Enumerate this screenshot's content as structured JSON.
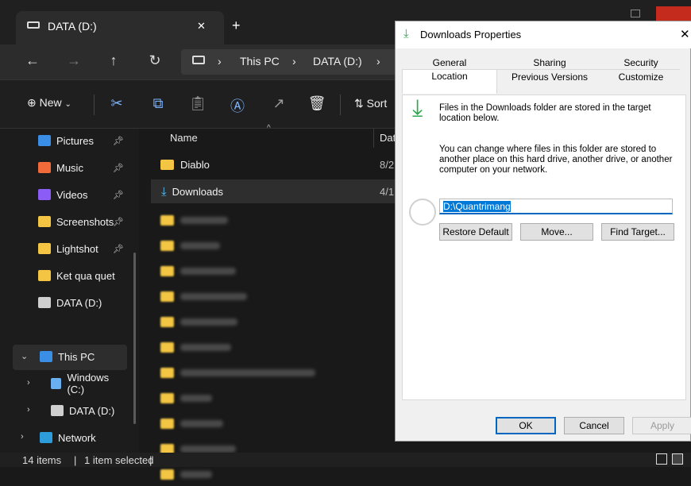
{
  "tab": {
    "title": "DATA (D:)",
    "close": "✕",
    "new": "+"
  },
  "nav": {
    "back": "←",
    "forward": "→",
    "up": "↑",
    "refresh": "↻"
  },
  "breadcrumb": {
    "items": [
      "This PC",
      "DATA (D:)"
    ],
    "sep": "›"
  },
  "toolbar": {
    "new_label": "New",
    "sort_label": "Sort"
  },
  "sidebar": {
    "items": [
      {
        "label": "Pictures",
        "icon": "pictures-icon",
        "color": "#3a8ee6"
      },
      {
        "label": "Music",
        "icon": "music-icon",
        "color": "#f06a3a"
      },
      {
        "label": "Videos",
        "icon": "videos-icon",
        "color": "#8b5cf6"
      },
      {
        "label": "Screenshots",
        "icon": "folder-icon",
        "color": "#f4c542"
      },
      {
        "label": "Lightshot",
        "icon": "folder-icon",
        "color": "#f4c542"
      },
      {
        "label": "Ket qua quet",
        "icon": "folder-icon",
        "color": "#f4c542"
      },
      {
        "label": "DATA (D:)",
        "icon": "drive-icon",
        "color": "#cfcfcf"
      }
    ],
    "tree": [
      {
        "label": "This PC"
      },
      {
        "label": "Windows (C:)"
      },
      {
        "label": "DATA (D:)"
      },
      {
        "label": "Network"
      }
    ]
  },
  "list": {
    "columns": {
      "name": "Name",
      "date": "Dat"
    },
    "rows": [
      {
        "name": "Diablo",
        "date": "8/2"
      },
      {
        "name": "Downloads",
        "date": "4/1"
      }
    ]
  },
  "status": {
    "items": "14 items",
    "selected": "1 item selected"
  },
  "dialog": {
    "title": "Downloads Properties",
    "tabs_row1": [
      "General",
      "Sharing",
      "Security"
    ],
    "tabs_row2": [
      "Location",
      "Previous Versions",
      "Customize"
    ],
    "desc1": "Files in the Downloads folder are stored in the target location below.",
    "desc2": "You can change where files in this folder are stored to another place on this hard drive, another drive, or another computer on your network.",
    "path": "D:\\Quantrimang",
    "buttons": {
      "restore": "Restore Default",
      "move": "Move...",
      "find": "Find Target..."
    },
    "footer": {
      "ok": "OK",
      "cancel": "Cancel",
      "apply": "Apply"
    }
  },
  "colors": {
    "accent": "#0078d7",
    "folder": "#f4c542",
    "download": "#2da84e"
  }
}
